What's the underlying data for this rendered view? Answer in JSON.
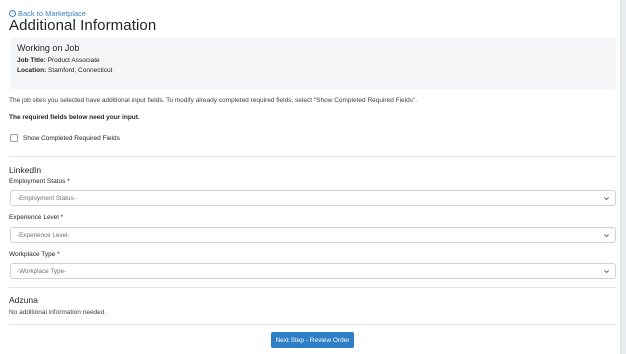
{
  "back_link": {
    "label": "Back to Marketplace"
  },
  "page_title": "Additional Information",
  "job_card": {
    "title": "Working on Job",
    "job_title_label": "Job Title:",
    "job_title_value": " Product Associate",
    "location_label": "Location:",
    "location_value": " Stamford, Connecticut"
  },
  "info_text": "The job sites you selected have additional input fields. To modify already completed required fields, select \"Show Completed Required Fields\".",
  "required_text": "The required fields below need your input.",
  "show_completed": {
    "label": "Show Completed Required Fields",
    "checked": false
  },
  "sections": {
    "linkedin": {
      "title": "LinkedIn",
      "employment_status": {
        "label": "Employment Status *",
        "selected": "-Employment Status-"
      },
      "experience_level": {
        "label": "Experience Level *",
        "selected": "-Experience Level-"
      },
      "workplace_type": {
        "label": "Workplace Type *",
        "selected": "-Workplace Type-"
      }
    },
    "adzuna": {
      "title": "Adzuna",
      "message": "No additional information needed."
    }
  },
  "next_button": {
    "label": "Next Step - Review Order"
  },
  "colors": {
    "accent": "#2f7fc6",
    "link": "#3b82c4",
    "card_bg": "#f5f6f7"
  },
  "icons": {
    "back": "circle-arrow-left-icon",
    "dropdown": "chevron-down-icon"
  }
}
